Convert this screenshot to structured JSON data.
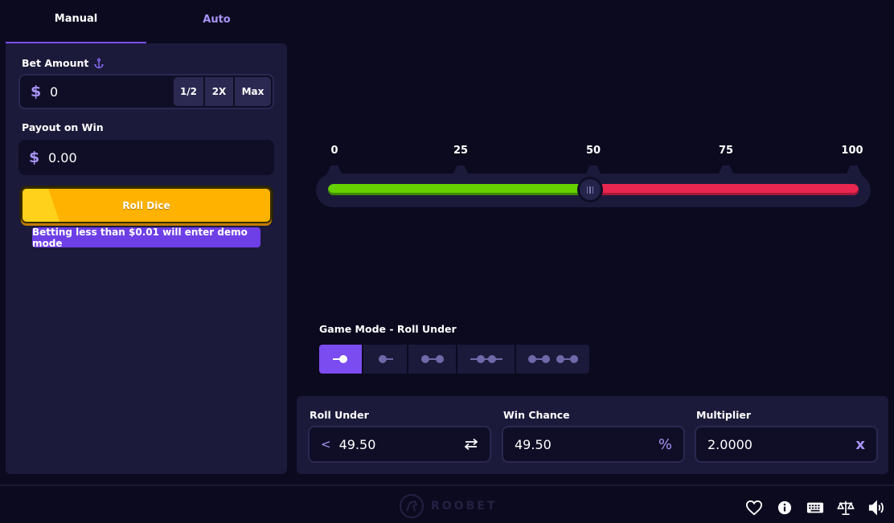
{
  "tabs": [
    {
      "label": "Manual",
      "active": true
    },
    {
      "label": "Auto",
      "active": false
    }
  ],
  "bet": {
    "label": "Bet Amount",
    "currency_symbol": "$",
    "value": "0",
    "buttons": [
      "1/2",
      "2X",
      "Max"
    ]
  },
  "payout": {
    "label": "Payout on Win",
    "currency_symbol": "$",
    "value": "0.00"
  },
  "roll_button_label": "Roll Dice",
  "demo_note": "Betting less than $0.01 will enter demo mode",
  "slider": {
    "ticks": [
      "0",
      "25",
      "50",
      "75",
      "100"
    ],
    "value": 49.5,
    "min": 0,
    "max": 100,
    "colors": {
      "under": "#66d000",
      "over": "#e8264f"
    }
  },
  "game_mode": {
    "label": "Game Mode - Roll Under",
    "options": [
      "roll-under",
      "roll-over",
      "roll-between",
      "roll-outside",
      "roll-between-two"
    ]
  },
  "stats": {
    "roll_under": {
      "label": "Roll Under",
      "prefix": "<",
      "value": "49.50"
    },
    "win_chance": {
      "label": "Win Chance",
      "value": "49.50",
      "suffix": "%"
    },
    "multiplier": {
      "label": "Multiplier",
      "value": "2.0000",
      "suffix": "x"
    }
  },
  "footer": {
    "brand": "ROOBET",
    "icons": [
      "heart-icon",
      "info-icon",
      "keyboard-icon",
      "scales-icon",
      "volume-icon"
    ]
  },
  "colors": {
    "accent": "#7b4cf0",
    "roll_button": "#ffb300",
    "background": "#0b0a1f",
    "panel": "#1c1a3b"
  }
}
